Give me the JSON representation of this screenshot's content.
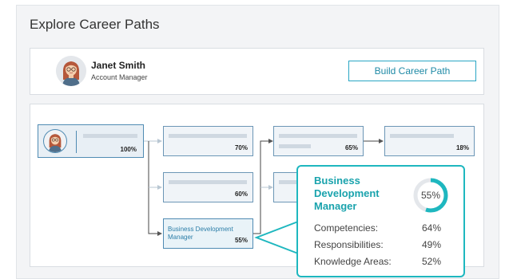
{
  "page": {
    "title": "Explore Career Paths"
  },
  "profile": {
    "name": "Janet Smith",
    "role": "Account Manager",
    "avatar_icon": "woman-avatar-icon",
    "button_label": "Build Career Path"
  },
  "path": {
    "start": {
      "percent": "100%"
    },
    "nodes": [
      {
        "id": "n1",
        "label": "",
        "percent": "70%"
      },
      {
        "id": "n2",
        "label": "",
        "percent": "60%"
      },
      {
        "id": "n3",
        "label": "Business Development Manager",
        "percent": "55%"
      },
      {
        "id": "n4",
        "label": "",
        "percent": "65%"
      },
      {
        "id": "n5",
        "label": "",
        "percent": "18%"
      }
    ]
  },
  "popup": {
    "title": "Business Development Manager",
    "match_percent": "55%",
    "match_value": 55,
    "accent": "#1eb7bf",
    "stats": [
      {
        "label": "Competencies:",
        "value": "64%"
      },
      {
        "label": "Responsibilities:",
        "value": "49%"
      },
      {
        "label": "Knowledge Areas:",
        "value": "52%"
      }
    ]
  }
}
